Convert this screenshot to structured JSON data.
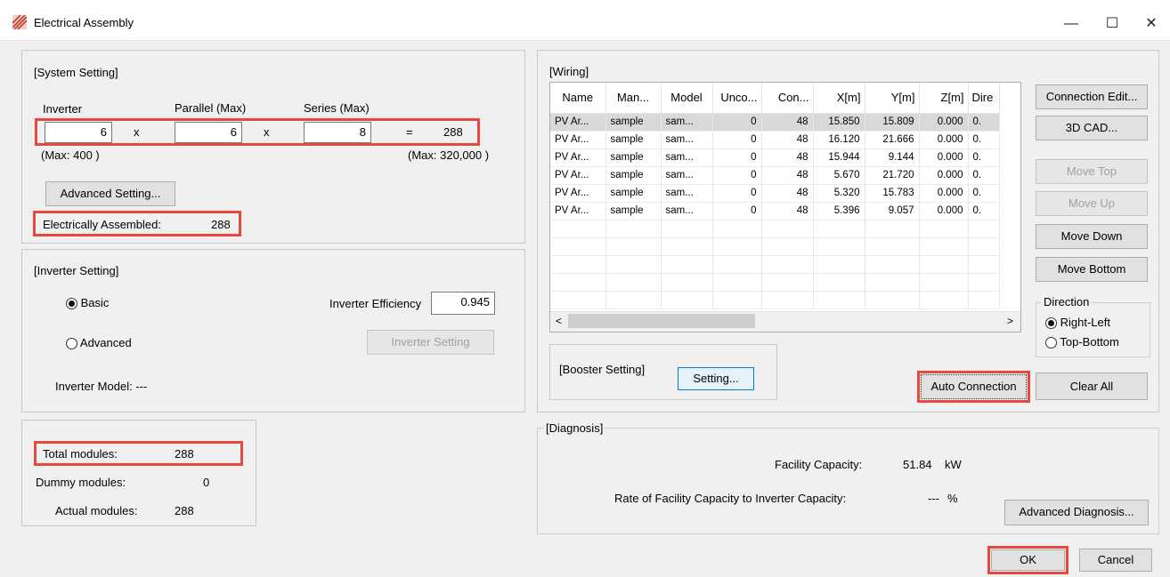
{
  "window": {
    "title": "Electrical Assembly"
  },
  "system": {
    "heading": "[System Setting]",
    "inverter_label": "Inverter",
    "parallel_label": "Parallel (Max)",
    "series_label": "Series (Max)",
    "inverter_value": "6",
    "parallel_value": "6",
    "series_value": "8",
    "x": "x",
    "eq": "=",
    "total": "288",
    "max_left": "(Max:  400 )",
    "max_right": "(Max:  320,000  )",
    "advanced_button": "Advanced Setting...",
    "assembled_label": "Electrically Assembled:",
    "assembled_value": "288"
  },
  "inverter_setting": {
    "heading": "[Inverter Setting]",
    "basic": "Basic",
    "advanced": "Advanced",
    "efficiency_label": "Inverter Efficiency",
    "efficiency_value": "0.945",
    "setting_button": "Inverter Setting",
    "model_label": "Inverter Model:  ---"
  },
  "modules": {
    "total_label": "Total modules:",
    "total_value": "288",
    "dummy_label": "Dummy modules:",
    "dummy_value": "0",
    "actual_label": "Actual modules:",
    "actual_value": "288"
  },
  "wiring": {
    "heading": "[Wiring]",
    "columns": [
      "Name",
      "Man...",
      "Model",
      "Unco...",
      "Con...",
      "X[m]",
      "Y[m]",
      "Z[m]",
      "Dire"
    ],
    "rows": [
      [
        "PV Ar...",
        "sample",
        "sam...",
        "0",
        "48",
        "15.850",
        "15.809",
        "0.000",
        "0."
      ],
      [
        "PV Ar...",
        "sample",
        "sam...",
        "0",
        "48",
        "16.120",
        "21.666",
        "0.000",
        "0."
      ],
      [
        "PV Ar...",
        "sample",
        "sam...",
        "0",
        "48",
        "15.944",
        "9.144",
        "0.000",
        "0."
      ],
      [
        "PV Ar...",
        "sample",
        "sam...",
        "0",
        "48",
        "5.670",
        "21.720",
        "0.000",
        "0."
      ],
      [
        "PV Ar...",
        "sample",
        "sam...",
        "0",
        "48",
        "5.320",
        "15.783",
        "0.000",
        "0."
      ],
      [
        "PV Ar...",
        "sample",
        "sam...",
        "0",
        "48",
        "5.396",
        "9.057",
        "0.000",
        "0."
      ]
    ],
    "buttons": {
      "connection_edit": "Connection Edit...",
      "cad": "3D CAD...",
      "move_top": "Move Top",
      "move_up": "Move Up",
      "move_down": "Move Down",
      "move_bottom": "Move Bottom",
      "auto_connection": "Auto Connection",
      "clear_all": "Clear All"
    },
    "direction_label": "Direction",
    "right_left": "Right-Left",
    "top_bottom": "Top-Bottom",
    "booster_label": "[Booster Setting]",
    "booster_button": "Setting..."
  },
  "diagnosis": {
    "heading": "[Diagnosis]",
    "capacity_label": "Facility Capacity:",
    "capacity_value": "51.84",
    "capacity_unit": "kW",
    "rate_label": "Rate of Facility Capacity to Inverter Capacity:",
    "rate_value": "---",
    "rate_unit": "%",
    "advanced_button": "Advanced Diagnosis..."
  },
  "footer": {
    "ok": "OK",
    "cancel": "Cancel"
  },
  "colors": {
    "highlight": "#e8493f",
    "selected_row": "#d9d9d9"
  }
}
